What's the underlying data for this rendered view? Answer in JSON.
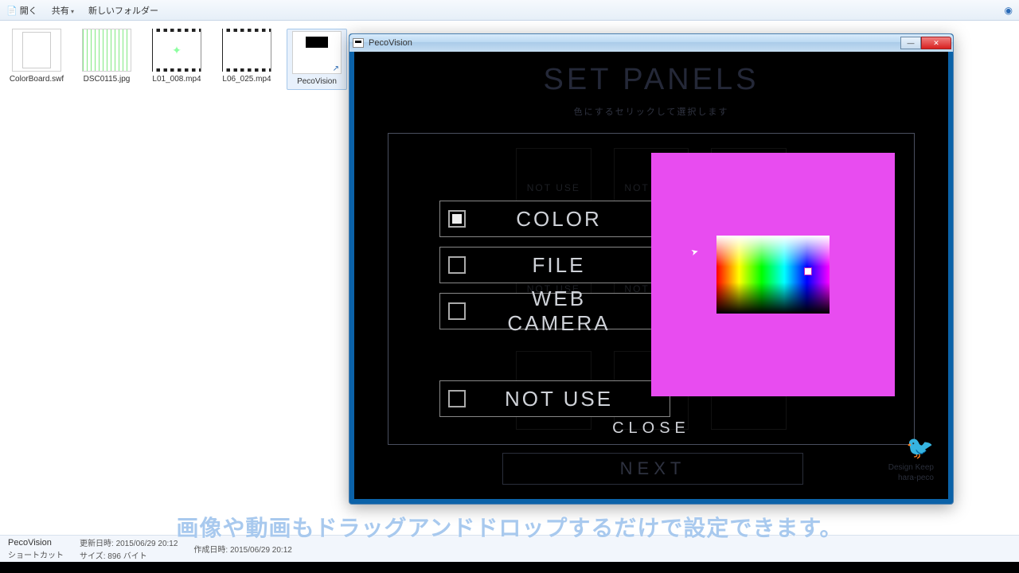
{
  "toolbar": {
    "open": "開く",
    "share": "共有",
    "newfolder": "新しいフォルダー"
  },
  "files": [
    {
      "label": "ColorBoard.swf"
    },
    {
      "label": "DSC0115.jpg"
    },
    {
      "label": "L01_008.mp4"
    },
    {
      "label": "L06_025.mp4"
    },
    {
      "label": "PecoVision"
    }
  ],
  "status": {
    "name": "PecoVision",
    "mod_label": "更新日時:",
    "mod_value": "2015/06/29 20:12",
    "create_label": "作成日時:",
    "create_value": "2015/06/29 20:12",
    "type_label": "ショートカット",
    "size_label": "サイズ:",
    "size_value": "896 バイト"
  },
  "app": {
    "title": "PecoVision",
    "heading": "SET PANELS",
    "subline": "色にするセリックして選択します",
    "grid_label": "NOT USE",
    "options": {
      "color": "COLOR",
      "file": "FILE",
      "webcam": "WEB CAMERA",
      "notuse": "NOT USE"
    },
    "close": "CLOSE",
    "next": "NEXT",
    "logo_lines": [
      "Design Keep",
      "hara-peco"
    ]
  },
  "subtitle": "画像や動画もドラッグアンドドロップするだけで設定できます。"
}
